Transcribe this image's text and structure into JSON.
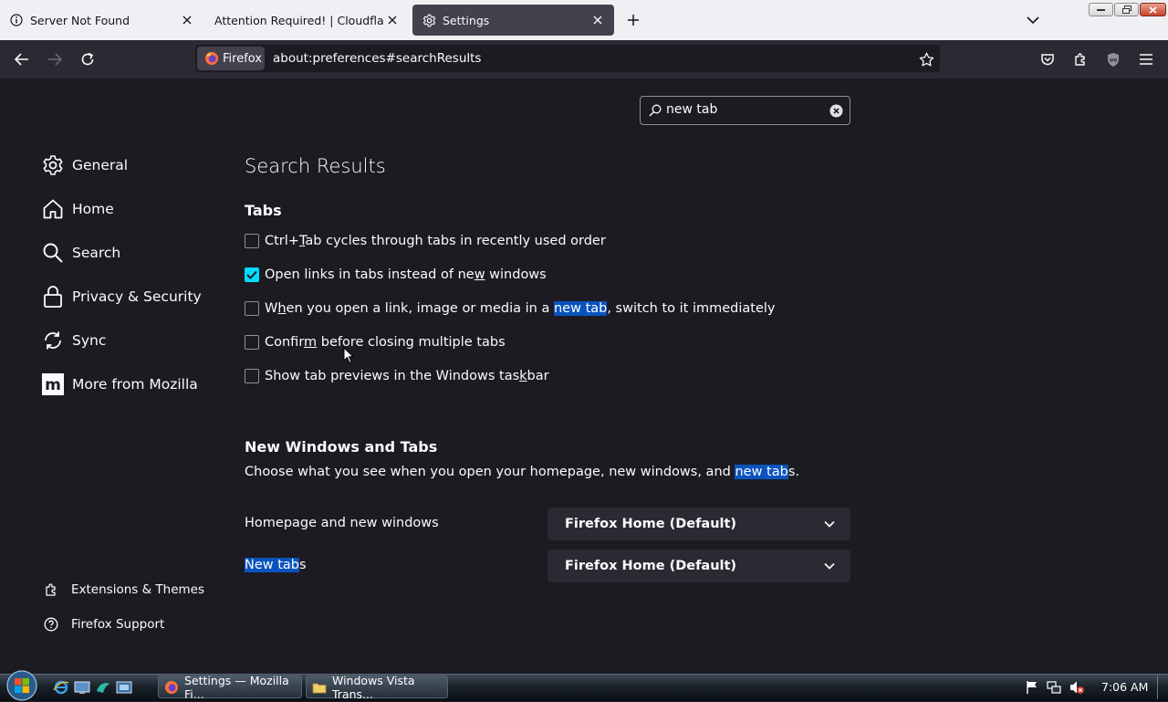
{
  "window": {
    "tabs": [
      {
        "title": "Server Not Found",
        "icon": "info-icon",
        "active": false
      },
      {
        "title": "Attention Required! | Cloudflare",
        "icon": "none",
        "active": false
      },
      {
        "title": "Settings",
        "icon": "gear-icon",
        "active": true
      }
    ]
  },
  "navbar": {
    "identity_label": "Firefox",
    "url": "about:preferences#searchResults"
  },
  "search": {
    "value": "new tab"
  },
  "sidebar": {
    "categories": [
      {
        "label": "General",
        "icon": "gear-icon"
      },
      {
        "label": "Home",
        "icon": "home-icon"
      },
      {
        "label": "Search",
        "icon": "search-icon"
      },
      {
        "label": "Privacy & Security",
        "icon": "lock-icon"
      },
      {
        "label": "Sync",
        "icon": "sync-icon"
      },
      {
        "label": "More from Mozilla",
        "icon": "mozilla-icon"
      }
    ],
    "footer": [
      {
        "label": "Extensions & Themes",
        "icon": "puzzle-icon"
      },
      {
        "label": "Firefox Support",
        "icon": "help-icon"
      }
    ]
  },
  "main": {
    "title": "Search Results",
    "tabs_section": {
      "heading": "Tabs",
      "options": [
        {
          "pre": "Ctrl+",
          "key": "T",
          "mid": "ab cycles through tabs in recently used order",
          "hl": "",
          "post": "",
          "checked": false
        },
        {
          "pre": "Open links in tabs instead of ne",
          "key": "w",
          "mid": " windows",
          "hl": "",
          "post": "",
          "checked": true
        },
        {
          "pre": "W",
          "key": "h",
          "mid": "en you open a link, image or media in a ",
          "hl": "new tab",
          "post": ", switch to it immediately",
          "checked": false
        },
        {
          "pre": "Confir",
          "key": "m",
          "mid": " before closing multiple tabs",
          "hl": "",
          "post": "",
          "checked": false
        },
        {
          "pre": "Show tab previews in the Windows tas",
          "key": "k",
          "mid": "bar",
          "hl": "",
          "post": "",
          "checked": false
        }
      ]
    },
    "new_windows_section": {
      "heading": "New Windows and Tabs",
      "description_pre": "Choose what you see when you open your homepage, new windows, and ",
      "description_hl": "new tab",
      "description_post": "s.",
      "rows": [
        {
          "label_hl": "",
          "label": "Homepage and new windows",
          "value": "Firefox Home (Default)"
        },
        {
          "label_hl": "New tab",
          "label": "s",
          "value": "Firefox Home (Default)"
        }
      ]
    }
  },
  "taskbar": {
    "tasks": [
      {
        "label": "Settings — Mozilla Fi...",
        "icon": "firefox-icon"
      },
      {
        "label": "Windows Vista Trans...",
        "icon": "folder-icon"
      }
    ],
    "clock": "7:06 AM"
  },
  "colors": {
    "page_bg": "#1c1b22",
    "accent_checkbox": "#00ddff",
    "highlight": "#0a53be",
    "tabstrip_bg": "#f0f0f4"
  }
}
